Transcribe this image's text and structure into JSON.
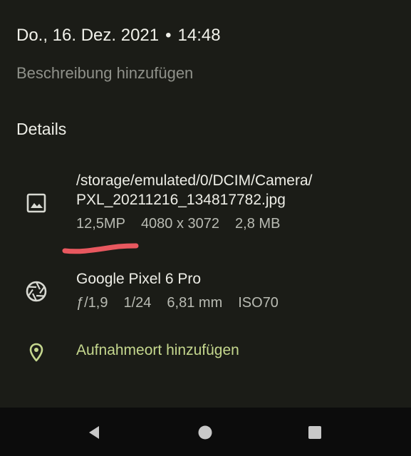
{
  "header": {
    "date": "Do., 16. Dez. 2021",
    "separator": "•",
    "time": "14:48"
  },
  "description": {
    "placeholder": "Beschreibung hinzufügen"
  },
  "details": {
    "heading": "Details",
    "file": {
      "icon": "image-icon",
      "path_line1": "/storage/emulated/0/DCIM/Camera/",
      "path_line2": "PXL_20211216_134817782.jpg",
      "megapixels": "12,5MP",
      "resolution": "4080 x 3072",
      "size": "2,8 MB"
    },
    "camera": {
      "icon": "aperture-icon",
      "model": "Google Pixel 6 Pro",
      "aperture": "ƒ/1,9",
      "shutter": "1/24",
      "focal_length": "6,81 mm",
      "iso": "ISO70"
    },
    "location": {
      "icon": "location-pin-icon",
      "label": "Aufnahmeort hinzufügen"
    }
  },
  "colors": {
    "background": "#1b1c17",
    "accent": "#c5d78e",
    "annotation": "#e8585f",
    "navbar": "#0c0c0c"
  },
  "navbar": {
    "back_icon": "back-triangle-icon",
    "home_icon": "home-circle-icon",
    "recents_icon": "recents-square-icon"
  }
}
